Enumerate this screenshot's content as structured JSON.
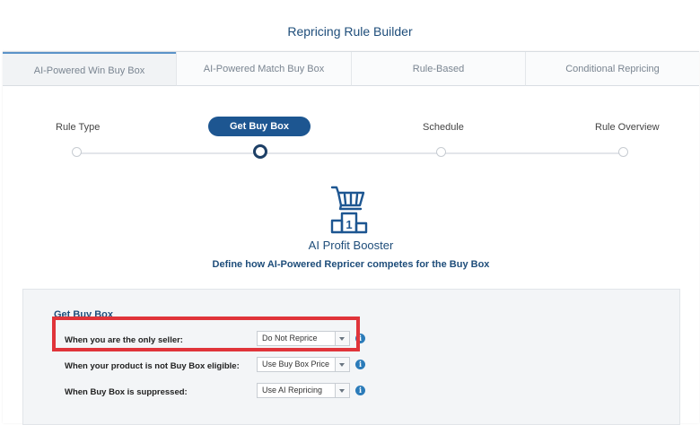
{
  "header": {
    "title": "Repricing Rule Builder"
  },
  "tabs": [
    {
      "label": "AI-Powered Win Buy Box",
      "active": true
    },
    {
      "label": "AI-Powered Match Buy Box",
      "active": false
    },
    {
      "label": "Rule-Based",
      "active": false
    },
    {
      "label": "Conditional Repricing",
      "active": false
    }
  ],
  "stepper": {
    "steps": [
      "Rule Type",
      "Get Buy Box",
      "Schedule",
      "Rule Overview"
    ],
    "active_step": "Get Buy Box"
  },
  "hero": {
    "icon": "cart-podium-icon",
    "title": "AI Profit Booster",
    "subtitle": "Define how AI-Powered Repricer competes for the Buy Box"
  },
  "panel": {
    "title": "Get Buy Box",
    "rows": [
      {
        "label": "When you are the only seller:",
        "value": "Do Not Reprice"
      },
      {
        "label": "When your product is not Buy Box eligible:",
        "value": "Use Buy Box Price"
      },
      {
        "label": "When Buy Box is suppressed:",
        "value": "Use AI Repricing"
      }
    ]
  },
  "colors": {
    "accent": "#1d5691",
    "highlight": "#e0343a",
    "info": "#2b7bb9"
  }
}
